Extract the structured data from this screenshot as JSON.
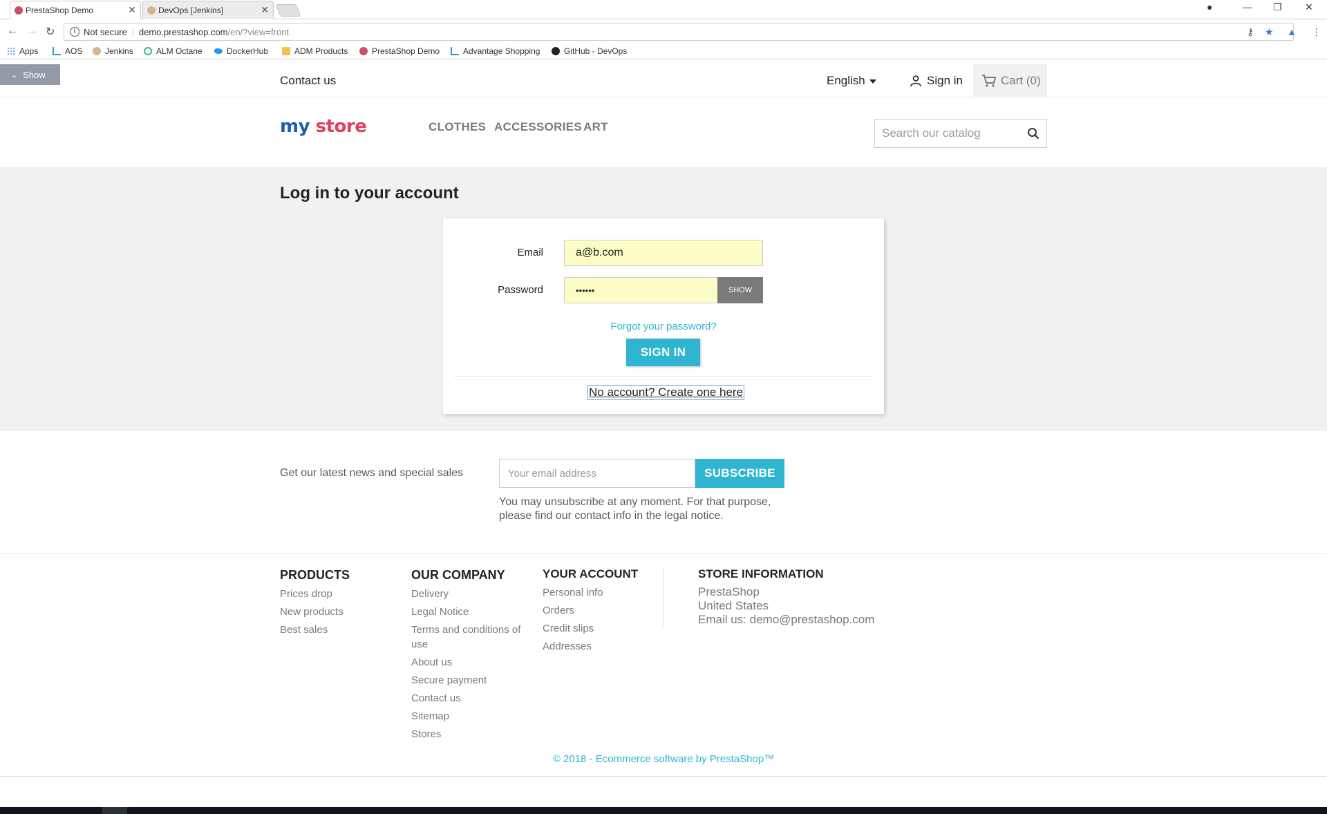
{
  "browser": {
    "tabs": [
      {
        "label": "PrestaShop Demo",
        "active": true
      },
      {
        "label": "DevOps [Jenkins]",
        "active": false
      }
    ],
    "security_label": "Not secure",
    "url_host": "demo.prestashop.com",
    "url_path": "/en/?view=front",
    "bookmarks": [
      "Apps",
      "AOS",
      "Jenkins",
      "ALM Octane",
      "DockerHub",
      "ADM Products",
      "PrestaShop Demo",
      "Advantage Shopping",
      "GitHub - DevOps"
    ]
  },
  "show_toggle": "Show",
  "topnav": {
    "contact": "Contact us",
    "language": "English",
    "signin": "Sign in",
    "cart": "Cart (0)"
  },
  "header": {
    "logo_part1": "my",
    "logo_part2": "store",
    "menu": [
      "CLOTHES",
      "ACCESSORIES",
      "ART"
    ],
    "search_placeholder": "Search our catalog"
  },
  "login": {
    "title": "Log in to your account",
    "email_label": "Email",
    "email_value": "a@b.com",
    "password_label": "Password",
    "password_value": "••••••",
    "show_label": "SHOW",
    "forgot": "Forgot your password?",
    "signin_button": "SIGN IN",
    "create_account": "No account? Create one here"
  },
  "newsletter": {
    "text": "Get our latest news and special sales",
    "placeholder": "Your email address",
    "button": "SUBSCRIBE",
    "note_line1": "You may unsubscribe at any moment. For that purpose,",
    "note_line2": "please find our contact info in the legal notice."
  },
  "footer": {
    "products": {
      "title": "PRODUCTS",
      "links": [
        "Prices drop",
        "New products",
        "Best sales"
      ]
    },
    "company": {
      "title": "OUR COMPANY",
      "links": [
        "Delivery",
        "Legal Notice",
        "Terms and conditions of",
        "use",
        "About us",
        "Secure payment",
        "Contact us",
        "Sitemap",
        "Stores"
      ]
    },
    "account": {
      "title": "YOUR ACCOUNT",
      "links": [
        "Personal info",
        "Orders",
        "Credit slips",
        "Addresses"
      ]
    },
    "store": {
      "title": "STORE INFORMATION",
      "lines": [
        "PrestaShop",
        "United States",
        "Email us: demo@prestashop.com"
      ]
    },
    "copyright": "© 2018 - Ecommerce software by PrestaShop™"
  },
  "colors": {
    "accent": "#2fb5d2",
    "autofill": "#fcfdc6",
    "page_bg": "#f1f1f1"
  }
}
